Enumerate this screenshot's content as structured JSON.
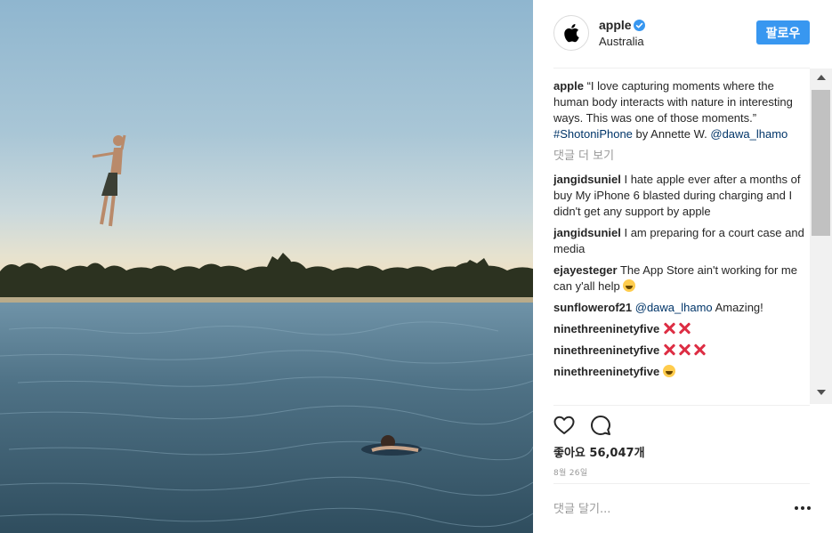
{
  "post": {
    "image_alt": "Person leaping above water at sunset with swimmer below",
    "account": {
      "username": "apple",
      "location": "Australia",
      "verified_icon": "verified-badge-icon",
      "avatar_icon": "apple-logo-icon",
      "follow_label": "팔로우"
    },
    "caption": {
      "username": "apple",
      "text_before": "“I love capturing moments where the human body interacts with nature in interesting ways. This was one of those moments.” ",
      "hashtag": "#ShotoniPhone",
      "text_middle": " by Annette W. ",
      "mention": "@dawa_lhamo"
    },
    "load_more_label": "댓글 더 보기",
    "comments": [
      {
        "username": "jangidsuniel",
        "text": "I hate apple ever after a months of buy My iPhone 6 blasted during charging and I didn't get any support by apple"
      },
      {
        "username": "jangidsuniel",
        "text": "I am preparing for a court case and media"
      },
      {
        "username": "ejayesteger",
        "text": "The App Store ain't working for me can y'all help"
      },
      {
        "username": "sunflowerof21",
        "mention": "@dawa_lhamo",
        "text": "Amazing!"
      },
      {
        "username": "ninethreeninetyfive",
        "text": ""
      },
      {
        "username": "ninethreeninetyfive",
        "text": ""
      },
      {
        "username": "ninethreeninetyfive",
        "text": ""
      }
    ],
    "likes_label": "좋아요 56,047개",
    "date": "8월 26일",
    "comment_placeholder": "댓글 달기...",
    "colors": {
      "accent": "#3897f0",
      "link": "#003569",
      "muted": "#999999",
      "text": "#262626"
    }
  }
}
